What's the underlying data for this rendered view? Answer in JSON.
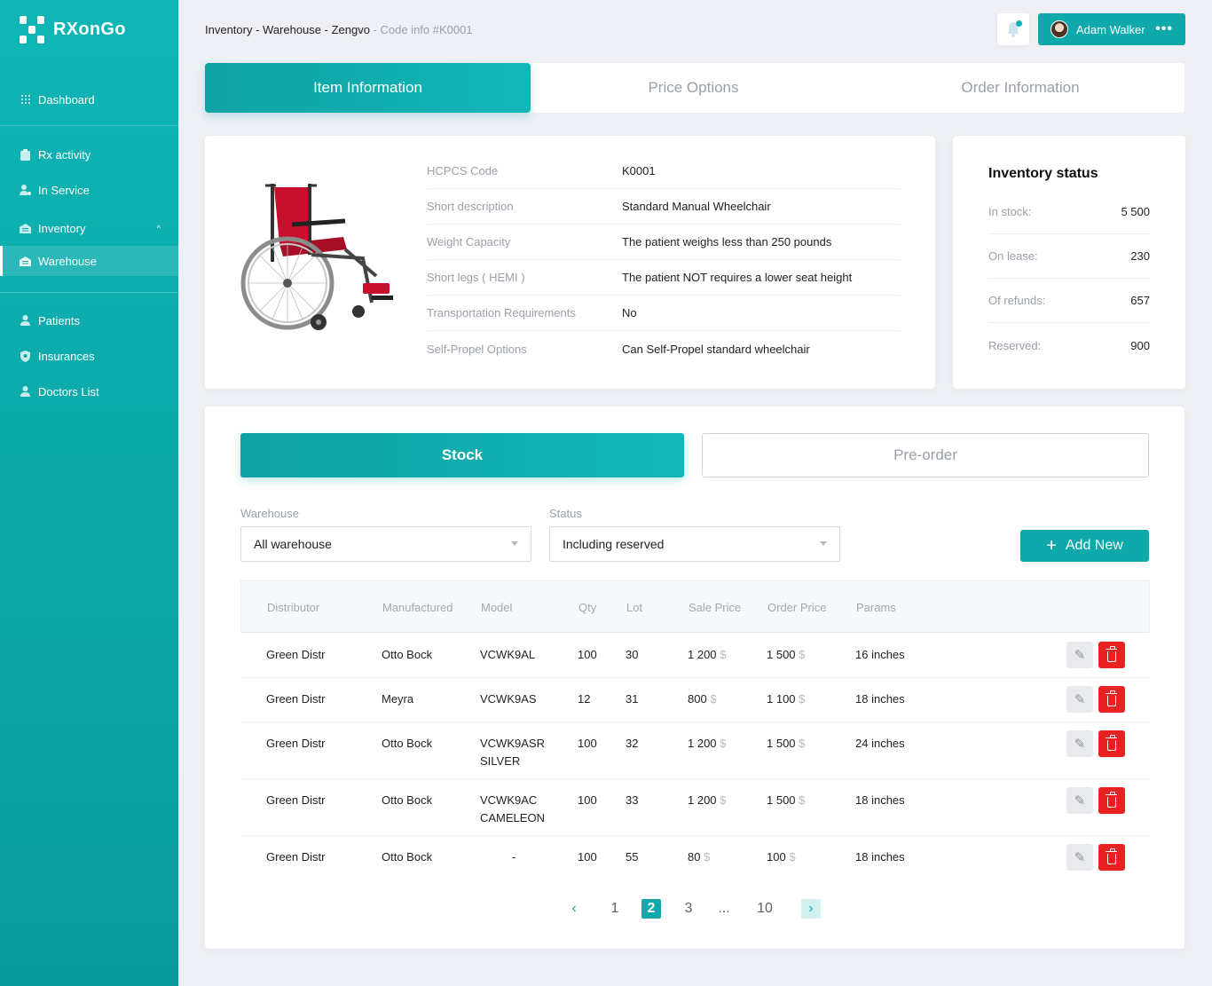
{
  "app": {
    "name": "RXonGo"
  },
  "sidebar": {
    "items": [
      {
        "label": "Dashboard",
        "icon": "grid-icon"
      },
      {
        "label": "Rx activity",
        "icon": "clipboard-icon"
      },
      {
        "label": "In Service",
        "icon": "user-gear-icon"
      },
      {
        "label": "Inventory",
        "icon": "box-icon"
      },
      {
        "label": "Warehouse",
        "icon": "warehouse-icon"
      },
      {
        "label": "Patients",
        "icon": "user-icon"
      },
      {
        "label": "Insurances",
        "icon": "shield-icon"
      },
      {
        "label": "Doctors List",
        "icon": "user-icon"
      }
    ]
  },
  "header": {
    "breadcrumb_path": "Inventory - Warehouse - Zengvo",
    "breadcrumb_tail": " - Code info #K0001",
    "user_name": "Adam Walker",
    "more": "•••"
  },
  "tabs": [
    "Item Information",
    "Price Options",
    "Order Information"
  ],
  "item": {
    "rows": [
      {
        "key": "HCPCS Code",
        "value": "K0001"
      },
      {
        "key": "Short description",
        "value": "Standard Manual Wheelchair"
      },
      {
        "key": "Weight Capacity",
        "value": "The patient weighs less than 250 pounds"
      },
      {
        "key": "Short legs ( HEMI )",
        "value": "The patient NOT requires a lower seat height"
      },
      {
        "key": "Transportation Requirements",
        "value": "No"
      },
      {
        "key": "Self-Propel Options",
        "value": "Can Self-Propel standard wheelchair"
      }
    ]
  },
  "inventory_status": {
    "title": "Inventory status",
    "rows": [
      {
        "key": "In stock:",
        "value": "5 500"
      },
      {
        "key": "On lease:",
        "value": "230"
      },
      {
        "key": "Of refunds:",
        "value": "657"
      },
      {
        "key": "Reserved:",
        "value": "900"
      }
    ]
  },
  "stock": {
    "stock_label": "Stock",
    "preorder_label": "Pre-order",
    "warehouse_label": "Warehouse",
    "warehouse_value": "All warehouse",
    "status_label": "Status",
    "status_value": "Including reserved",
    "add_new_label": "Add New",
    "add_icon": "+"
  },
  "table": {
    "headers": [
      "Distributor",
      "Manufactured",
      "Model",
      "Qty",
      "Lot",
      "Sale Price",
      "Order Price",
      "Params"
    ],
    "currency": "$",
    "rows": [
      {
        "distributor": "Green Distr",
        "manufactured": "Otto Bock",
        "model": "VCWK9AL",
        "qty": "100",
        "lot": "30",
        "sale": "1 200",
        "order": "1 500",
        "params": "16 inches"
      },
      {
        "distributor": "Green Distr",
        "manufactured": "Meyra",
        "model": "VCWK9AS",
        "qty": "12",
        "lot": "31",
        "sale": "800",
        "order": "1 100",
        "params": "18 inches"
      },
      {
        "distributor": "Green Distr",
        "manufactured": "Otto Bock",
        "model": "VCWK9ASR\nSILVER",
        "qty": "100",
        "lot": "32",
        "sale": "1 200",
        "order": "1 500",
        "params": "24 inches"
      },
      {
        "distributor": "Green Distr",
        "manufactured": "Otto Bock",
        "model": "VCWK9AC\nCAMELEON",
        "qty": "100",
        "lot": "33",
        "sale": "1 200",
        "order": "1 500",
        "params": "18 inches"
      },
      {
        "distributor": "Green Distr",
        "manufactured": "Otto Bock",
        "model": "-",
        "qty": "100",
        "lot": "55",
        "sale": "80",
        "order": "100",
        "params": "18 inches"
      }
    ]
  },
  "pagination": {
    "prev": "‹",
    "pages": [
      "1",
      "2",
      "3",
      "...",
      "10"
    ],
    "current": "2",
    "next": "›"
  }
}
